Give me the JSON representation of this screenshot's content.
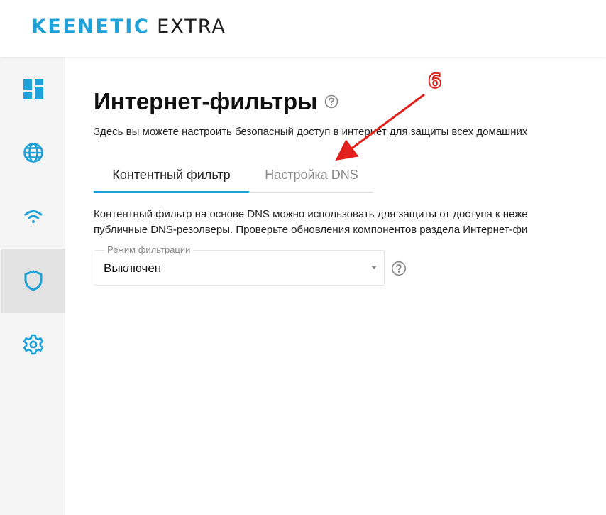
{
  "header": {
    "brand": "KEENETIC",
    "model": "EXTRA"
  },
  "sidebar": {
    "items": [
      {
        "name": "dashboard",
        "icon": "dashboard-icon",
        "active": false
      },
      {
        "name": "internet",
        "icon": "globe-icon",
        "active": false
      },
      {
        "name": "wifi",
        "icon": "wifi-icon",
        "active": false
      },
      {
        "name": "security",
        "icon": "shield-icon",
        "active": true
      },
      {
        "name": "settings",
        "icon": "gear-icon",
        "active": false
      }
    ]
  },
  "page": {
    "title": "Интернет-фильтры",
    "description": "Здесь вы можете настроить безопасный доступ в интернет для защиты всех домашних",
    "tabs": [
      {
        "label": "Контентный фильтр",
        "active": true
      },
      {
        "label": "Настройка DNS",
        "active": false
      }
    ],
    "paragraph_line1": "Контентный фильтр на основе DNS можно использовать для защиты от доступа к неже",
    "paragraph_line2": "публичные DNS-резолверы. Проверьте обновления компонентов раздела Интернет-фи",
    "filter_mode": {
      "label": "Режим фильтрации",
      "value": "Выключен"
    }
  },
  "annotation": {
    "number": "6",
    "color": "#e2211c"
  },
  "colors": {
    "accent": "#1da1d8",
    "sidebar_bg": "#f5f5f5",
    "sidebar_active": "#e3e3e3"
  }
}
